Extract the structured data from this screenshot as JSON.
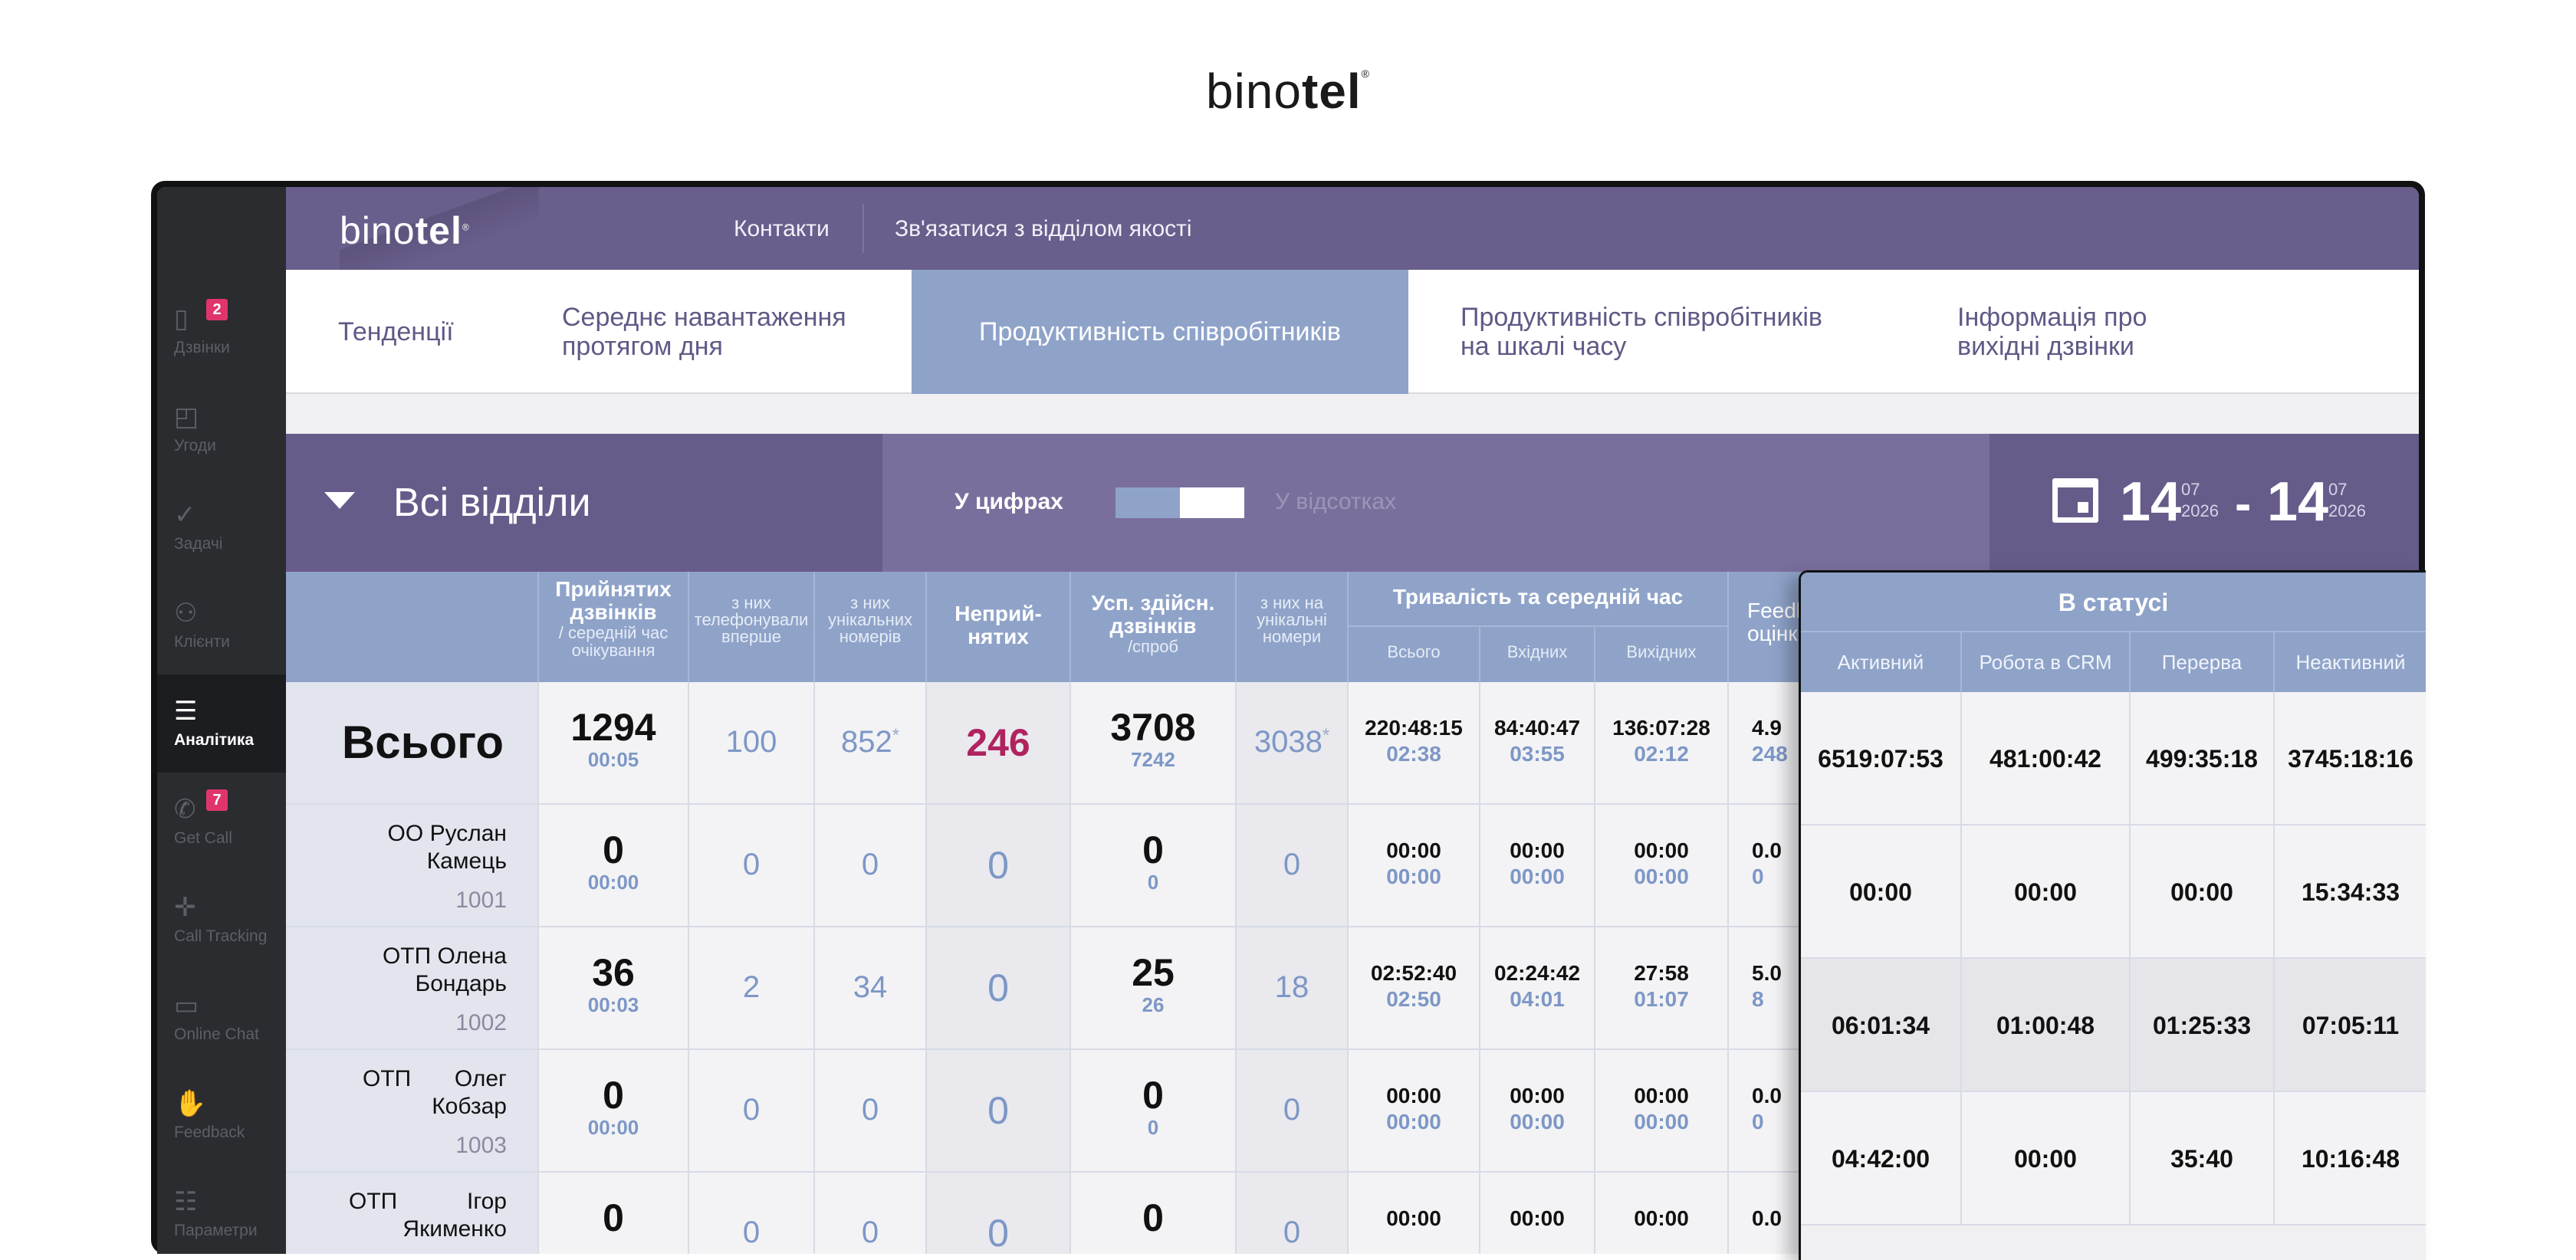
{
  "brand": {
    "name_light": "bino",
    "name_bold": "tel",
    "mark": "®"
  },
  "sidebar": {
    "items": [
      {
        "icon": "calls-icon",
        "glyph": "▯",
        "label": "Дзвінки",
        "badge": "2"
      },
      {
        "icon": "deals-icon",
        "glyph": "◰",
        "label": "Угоди",
        "badge": ""
      },
      {
        "icon": "check-icon",
        "glyph": "✓",
        "label": "Задачі",
        "badge": ""
      },
      {
        "icon": "user-icon",
        "glyph": "⚇",
        "label": "Клієнти",
        "badge": ""
      },
      {
        "icon": "analytics-icon",
        "glyph": "☰",
        "label": "Аналітика",
        "badge": ""
      },
      {
        "icon": "get-call-icon",
        "glyph": "✆",
        "label": "Get Call",
        "badge": "7"
      },
      {
        "icon": "call-tracking-icon",
        "glyph": "✛",
        "label": "Call Tracking",
        "badge": ""
      },
      {
        "icon": "chat-icon",
        "glyph": "▭",
        "label": "Online Chat",
        "badge": ""
      },
      {
        "icon": "feedback-icon",
        "glyph": "✋",
        "label": "Feedback",
        "badge": ""
      },
      {
        "icon": "settings-icon",
        "glyph": "☷",
        "label": "Параметри",
        "badge": ""
      }
    ],
    "active": "Аналітика"
  },
  "header": {
    "logo_light": "bino",
    "logo_bold": "tel",
    "logo_mark": "®",
    "links": [
      "Контакти",
      "Зв'язатися з відділом якості"
    ]
  },
  "tabs": [
    {
      "line1": "Тенденції",
      "line2": ""
    },
    {
      "line1": "Середнє навантаження",
      "line2": "протягом дня"
    },
    {
      "line1": "Продуктивність співробітників",
      "line2": "",
      "active": true
    },
    {
      "line1": "Продуктивність співробітників",
      "line2": "на шкалі часу"
    },
    {
      "line1": "Інформація про",
      "line2": "вихідні дзвінки"
    }
  ],
  "filter": {
    "department": "Всі відділи",
    "mode_numbers": "У цифрах",
    "mode_percent": "У відсотках",
    "date_from_day": "14",
    "date_from_month": "07",
    "date_from_year": "2026",
    "date_to_day": "14",
    "date_to_month": "07",
    "date_to_year": "2026",
    "date_separator": "-"
  },
  "table": {
    "headers": {
      "accepted": {
        "t1": "Прийнятих",
        "t1b": "дзвінків",
        "t2": "/ середній час",
        "t3": "очікування"
      },
      "first_time": {
        "a": "з них",
        "b": "телефонували",
        "c": "вперше"
      },
      "unique": {
        "a": "з них",
        "b": "унікальних",
        "c": "номерів"
      },
      "missed": {
        "a": "Неприй-",
        "b": "нятих"
      },
      "outgoing": {
        "a": "Усп. здійсн.",
        "b": "дзвінків",
        "c": "/спроб"
      },
      "out_unique": {
        "a": "з них на",
        "b": "унікальні",
        "c": "номери"
      },
      "duration": {
        "title": "Тривалість та середній час",
        "total": "Всього",
        "in": "Вхідних",
        "out": "Вихідних"
      },
      "feedback": {
        "a": "Feedback",
        "b": "оцінки"
      }
    },
    "total_label": "Всього",
    "total": {
      "accepted": "1294",
      "wait": "00:05",
      "first": "100",
      "unique": "852",
      "unique_star": "*",
      "missed": "246",
      "out": "3708",
      "attempts": "7242",
      "out_unique": "3038",
      "out_unique_star": "*",
      "dur_total": "220:48:15",
      "avg_total": "02:38",
      "dur_in": "84:40:47",
      "avg_in": "03:55",
      "dur_out": "136:07:28",
      "avg_out": "02:12",
      "fb": "4.9",
      "fb_count": "248"
    },
    "rows": [
      {
        "prefix": "ОО",
        "first": "Руслан",
        "last": "Камець",
        "ext": "1001",
        "accepted": "0",
        "wait": "00:00",
        "first_time": "0",
        "unique": "0",
        "missed": "0",
        "out": "0",
        "attempts": "0",
        "out_unique": "0",
        "dur_total": "00:00",
        "avg_total": "00:00",
        "dur_in": "00:00",
        "avg_in": "00:00",
        "dur_out": "00:00",
        "avg_out": "00:00",
        "fb": "0.0",
        "fb_count": "0"
      },
      {
        "prefix": "ОТП",
        "first": "Олена",
        "last": "Бондарь",
        "ext": "1002",
        "accepted": "36",
        "wait": "00:03",
        "first_time": "2",
        "unique": "34",
        "missed": "0",
        "out": "25",
        "attempts": "26",
        "out_unique": "18",
        "dur_total": "02:52:40",
        "avg_total": "02:50",
        "dur_in": "02:24:42",
        "avg_in": "04:01",
        "dur_out": "27:58",
        "avg_out": "01:07",
        "fb": "5.0",
        "fb_count": "8"
      },
      {
        "prefix": "ОТП",
        "first": "Олег",
        "last": "Кобзар",
        "ext": "1003",
        "accepted": "0",
        "wait": "00:00",
        "first_time": "0",
        "unique": "0",
        "missed": "0",
        "out": "0",
        "attempts": "0",
        "out_unique": "0",
        "dur_total": "00:00",
        "avg_total": "00:00",
        "dur_in": "00:00",
        "avg_in": "00:00",
        "dur_out": "00:00",
        "avg_out": "00:00",
        "fb": "0.0",
        "fb_count": "0"
      },
      {
        "prefix": "ОТП",
        "first": "Ігор",
        "last": "Якименко",
        "ext": "",
        "accepted": "0",
        "wait": "",
        "first_time": "0",
        "unique": "0",
        "missed": "0",
        "out": "0",
        "attempts": "",
        "out_unique": "0",
        "dur_total": "00:00",
        "avg_total": "",
        "dur_in": "00:00",
        "avg_in": "",
        "dur_out": "00:00",
        "avg_out": "",
        "fb": "0.0",
        "fb_count": ""
      }
    ]
  },
  "status_panel": {
    "title": "В статусі",
    "columns": [
      "Активний",
      "Робота в CRM",
      "Перерва",
      "Неактивний"
    ],
    "rows": [
      [
        "6519:07:53",
        "481:00:42",
        "499:35:18",
        "3745:18:16"
      ],
      [
        "00:00",
        "00:00",
        "00:00",
        "15:34:33"
      ],
      [
        "06:01:34",
        "01:00:48",
        "01:25:33",
        "07:05:11"
      ],
      [
        "04:42:00",
        "00:00",
        "35:40",
        "10:16:48"
      ]
    ]
  },
  "colors": {
    "header": "#6a5e8c",
    "accent": "#8fa3c9",
    "missed": "#b0235f",
    "badge": "#e0356b",
    "sidebar": "#2b2c30"
  }
}
